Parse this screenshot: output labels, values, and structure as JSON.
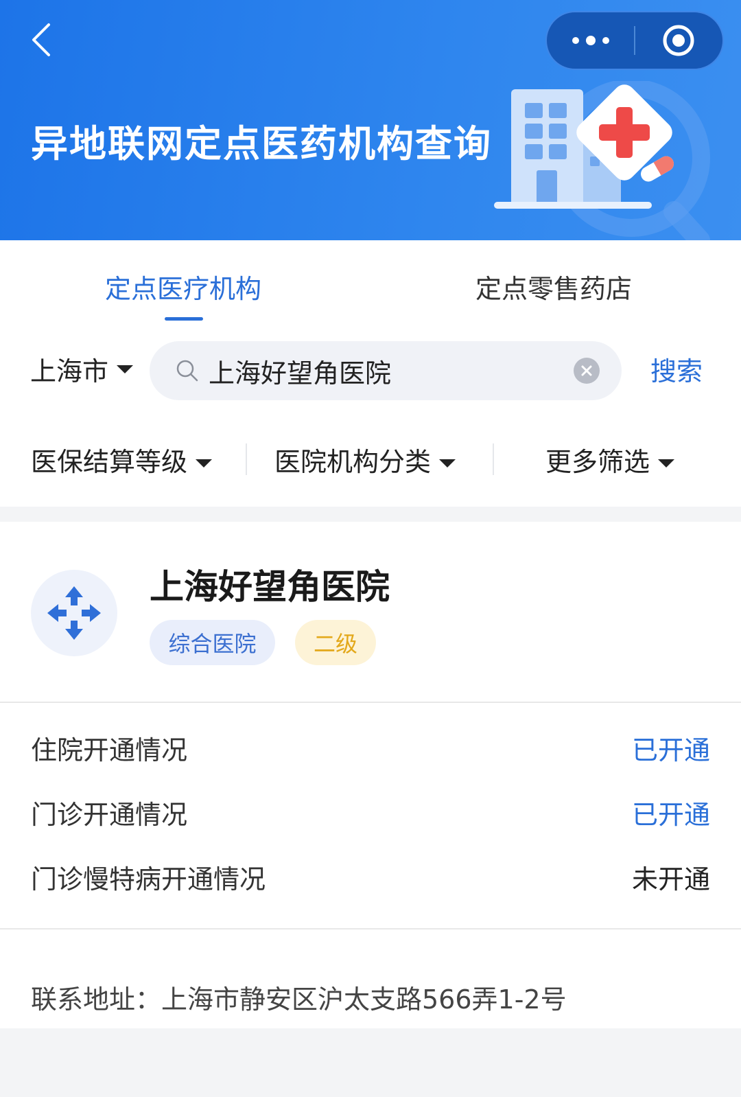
{
  "header": {
    "title": "异地联网定点医药机构查询",
    "back_icon": "chevron-left-icon",
    "more_icon": "more-dots-icon",
    "target_icon": "record-target-icon"
  },
  "tabs": [
    {
      "label": "定点医疗机构",
      "active": true
    },
    {
      "label": "定点零售药店",
      "active": false
    }
  ],
  "search": {
    "city": "上海市",
    "value": "上海好望角医院",
    "button_label": "搜索"
  },
  "filters": [
    {
      "label": "医保结算等级"
    },
    {
      "label": "医院机构分类"
    },
    {
      "label": "更多筛选"
    }
  ],
  "result": {
    "name": "上海好望角医院",
    "type_badge": "综合医院",
    "level_badge": "二级",
    "status_rows": [
      {
        "label": "住院开通情况",
        "value": "已开通"
      },
      {
        "label": "门诊开通情况",
        "value": "已开通"
      },
      {
        "label": "门诊慢特病开通情况",
        "value": "未开通"
      }
    ],
    "address": "联系地址：上海市静安区沪太支路566弄1-2号"
  },
  "colors": {
    "brand_blue": "#2a6fd8",
    "banner_blue": "#1d74e8",
    "level_badge_text": "#e3a81a"
  }
}
